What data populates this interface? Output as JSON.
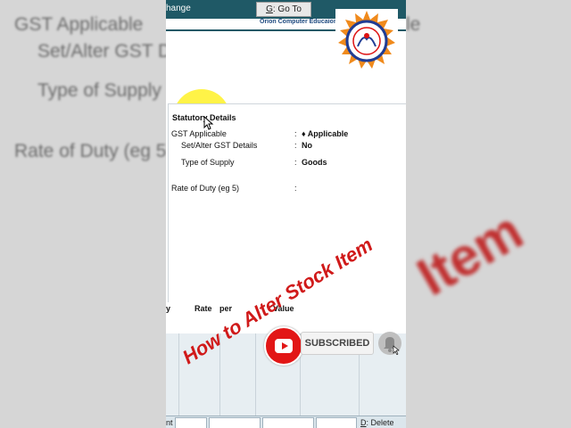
{
  "background": {
    "left_lines": [
      "GST Applicable",
      "Set/Alter GST D",
      "Type of Supply",
      "Rate of Duty (eg 5"
    ],
    "right_lines": [
      "le"
    ],
    "right_big": "Item"
  },
  "toolbar": {
    "change_label": "hange",
    "goto_label": "Go To",
    "goto_key": "G"
  },
  "header": {
    "org": "Orion Computer Educaion Council"
  },
  "statutory": {
    "heading": "Statutory Details",
    "rows": [
      {
        "label": "GST Applicable",
        "value": "♦ Applicable"
      },
      {
        "label": "Set/Alter GST Details",
        "value": "No"
      },
      {
        "label": "Type of Supply",
        "value": "Goods"
      },
      {
        "label": "Rate of Duty (eg 5)",
        "value": ""
      }
    ],
    "colon": ":"
  },
  "columns": {
    "qty": "y",
    "rate": "Rate",
    "per": "per",
    "value": "Value"
  },
  "footer": {
    "left_frag": "nt",
    "delete_key": "D",
    "delete_label": "Delete"
  },
  "overlay": {
    "title": "How to Alter Stock Item",
    "subscribe": "SUBSCRIBED"
  },
  "colors": {
    "topbar": "#1f5966",
    "overlay_red": "#d01a1a",
    "youtube_red": "#e21616"
  }
}
